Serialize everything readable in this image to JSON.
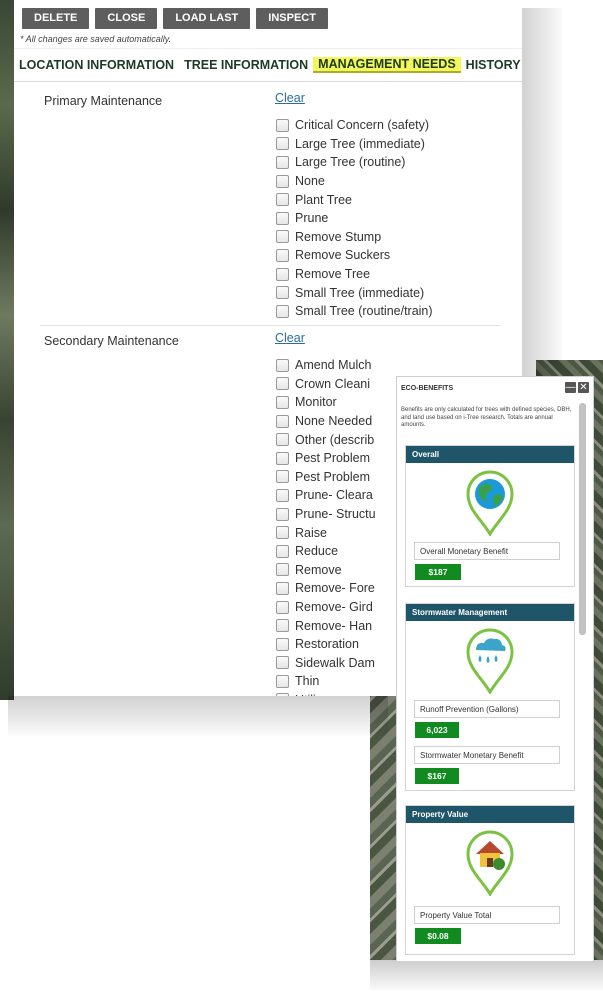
{
  "toolbar": {
    "delete_label": "DELETE",
    "close_label": "CLOSE",
    "load_last_label": "LOAD LAST",
    "inspect_label": "INSPECT"
  },
  "autosave_note": "* All changes are saved automatically.",
  "tabs": [
    {
      "label": "LOCATION INFORMATION",
      "active": false
    },
    {
      "label": "TREE INFORMATION",
      "active": false
    },
    {
      "label": "MANAGEMENT NEEDS",
      "active": true
    },
    {
      "label": "HISTORY",
      "active": false
    }
  ],
  "primary": {
    "label": "Primary Maintenance",
    "clear_label": "Clear",
    "options": [
      "Critical Concern (safety)",
      "Large Tree (immediate)",
      "Large Tree (routine)",
      "None",
      "Plant Tree",
      "Prune",
      "Remove Stump",
      "Remove Suckers",
      "Remove Tree",
      "Small Tree (immediate)",
      "Small Tree (routine/train)"
    ]
  },
  "secondary": {
    "label": "Secondary Maintenance",
    "clear_label": "Clear",
    "options": [
      "Amend Mulch",
      "Crown Cleani",
      "Monitor",
      "None Needed",
      "Other (describ",
      "Pest Problem",
      "Pest Problem",
      "Prune- Cleara",
      "Prune- Structu",
      "Raise",
      "Reduce",
      "Remove",
      "Remove- Fore",
      "Remove- Gird",
      "Remove- Han",
      "Restoration",
      "Sidewalk Dam",
      "Thin",
      "Utili"
    ]
  },
  "eco": {
    "title": "ECO-BENEFITS",
    "minimize_glyph": "—",
    "close_glyph": "✕",
    "note": "Benefits are only calculated for trees with defined species, DBH, and land use based on i-Tree research. Totals are annual amounts.",
    "cards": [
      {
        "title": "Overall",
        "icon": "globe-icon",
        "metrics": [
          {
            "label": "Overall Monetary Benefit",
            "value": "$187"
          }
        ]
      },
      {
        "title": "Stormwater Management",
        "icon": "rain-cloud-icon",
        "metrics": [
          {
            "label": "Runoff Prevention (Gallons)",
            "value": "6,023"
          },
          {
            "label": "Stormwater Monetary Benefit",
            "value": "$167"
          }
        ]
      },
      {
        "title": "Property Value",
        "icon": "house-icon",
        "metrics": [
          {
            "label": "Property Value Total",
            "value": "$0.08"
          }
        ]
      }
    ]
  },
  "colors": {
    "button_bg": "#5e5e5e",
    "tab_highlight": "#f3f75a",
    "card_header": "#1f5568",
    "value_green": "#118a1f",
    "pin_green": "#7cc242"
  }
}
